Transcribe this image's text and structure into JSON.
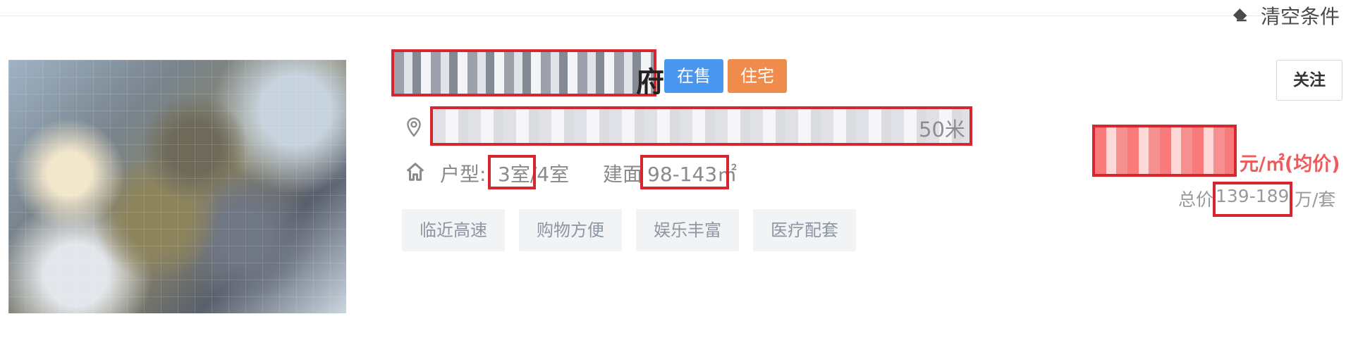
{
  "toolbar": {
    "clear_label": "清空条件"
  },
  "listing": {
    "title_visible_suffix": "府",
    "badges": {
      "sale": "在售",
      "type": "住宅"
    },
    "address_visible_suffix": "50米",
    "layout_label": "户型:",
    "layout_value": "3室/4室",
    "area_label": "建面",
    "area_value": "98-143㎡",
    "tags": [
      "临近高速",
      "购物方便",
      "娱乐丰富",
      "医疗配套"
    ],
    "follow_label": "关注",
    "price": {
      "unit": "元/㎡(均价)",
      "total_label": "总价",
      "total_value": "139-189",
      "total_unit": "万/套"
    }
  },
  "icons": {
    "clear": "eraser-icon",
    "location": "location-pin-icon",
    "home": "house-icon"
  },
  "colors": {
    "sale_badge": "#4b96ef",
    "type_badge": "#ef8b4b",
    "price": "#ef5b5b",
    "highlight": "#d7262e"
  }
}
